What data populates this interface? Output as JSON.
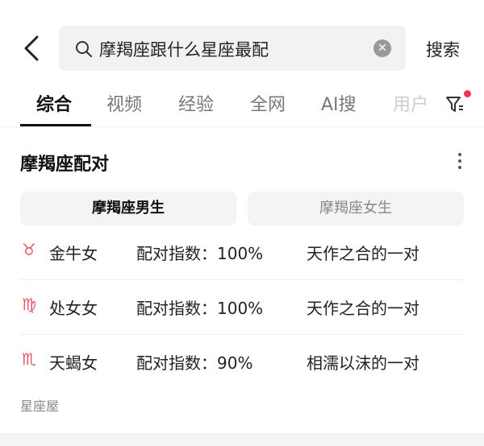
{
  "search": {
    "query": "摩羯座跟什么星座最配",
    "submit_label": "搜索"
  },
  "tabs": [
    {
      "label": "综合",
      "active": true
    },
    {
      "label": "视频"
    },
    {
      "label": "经验"
    },
    {
      "label": "全网"
    },
    {
      "label": "AI搜"
    },
    {
      "label": "用户"
    }
  ],
  "accent": "#e2576a",
  "card": {
    "title": "摩羯座配对",
    "segments": [
      {
        "label": "摩羯座男生",
        "selected": true
      },
      {
        "label": "摩羯座女生",
        "selected": false
      }
    ],
    "rows": [
      {
        "icon": "taurus-icon",
        "glyph": "♉",
        "name": "金牛女",
        "score": "配对指数：100%",
        "desc": "天作之合的一对"
      },
      {
        "icon": "virgo-icon",
        "glyph": "♍",
        "name": "处女女",
        "score": "配对指数：100%",
        "desc": "天作之合的一对"
      },
      {
        "icon": "scorpio-icon",
        "glyph": "♏",
        "name": "天蝎女",
        "score": "配对指数：90%",
        "desc": "相濡以沫的一对"
      }
    ],
    "source": "星座屋"
  }
}
